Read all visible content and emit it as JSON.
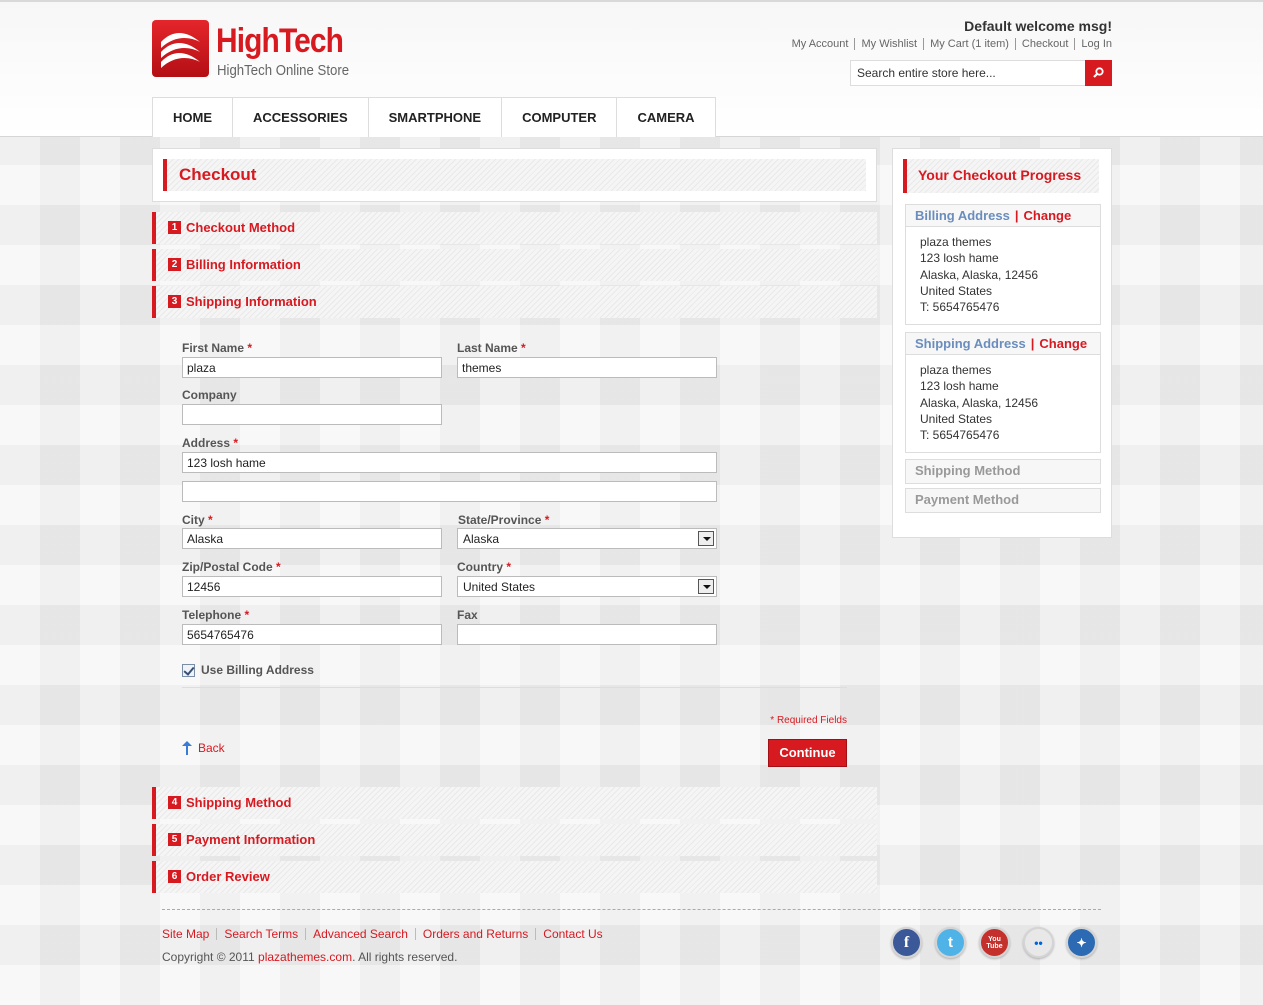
{
  "brand": {
    "title": "HighTech",
    "subtitle": "HighTech Online Store"
  },
  "header": {
    "welcome": "Default welcome msg!",
    "links": [
      "My Account",
      "My Wishlist",
      "My Cart (1 item)",
      "Checkout",
      "Log In"
    ],
    "search_placeholder": "Search entire store here..."
  },
  "nav": [
    "HOME",
    "ACCESSORIES",
    "SMARTPHONE",
    "COMPUTER",
    "CAMERA"
  ],
  "page_title": "Checkout",
  "steps": [
    {
      "num": "1",
      "label": "Checkout Method"
    },
    {
      "num": "2",
      "label": "Billing Information"
    },
    {
      "num": "3",
      "label": "Shipping Information"
    },
    {
      "num": "4",
      "label": "Shipping Method"
    },
    {
      "num": "5",
      "label": "Payment Information"
    },
    {
      "num": "6",
      "label": "Order Review"
    }
  ],
  "form": {
    "required_mark": "*",
    "first_name": {
      "label": "First Name",
      "value": "plaza"
    },
    "last_name": {
      "label": "Last Name",
      "value": "themes"
    },
    "company": {
      "label": "Company",
      "value": ""
    },
    "address": {
      "label": "Address",
      "line1": "123 losh hame",
      "line2": ""
    },
    "city": {
      "label": "City",
      "value": "Alaska"
    },
    "state": {
      "label": "State/Province",
      "value": "Alaska"
    },
    "zip": {
      "label": "Zip/Postal Code",
      "value": "12456"
    },
    "country": {
      "label": "Country",
      "value": "United States"
    },
    "telephone": {
      "label": "Telephone",
      "value": "5654765476"
    },
    "fax": {
      "label": "Fax",
      "value": ""
    },
    "use_billing": {
      "label": "Use Billing Address",
      "checked": true
    },
    "required_note": "* Required Fields",
    "back_label": "Back",
    "continue_label": "Continue"
  },
  "sidebar": {
    "title": "Your Checkout Progress",
    "change_label": "Change",
    "separator": "|",
    "billing": {
      "heading": "Billing Address",
      "lines": [
        "plaza themes",
        "123 losh hame",
        "Alaska, Alaska, 12456",
        "United States",
        "T: 5654765476"
      ]
    },
    "shipping": {
      "heading": "Shipping Address",
      "lines": [
        "plaza themes",
        "123 losh hame",
        "Alaska, Alaska, 12456",
        "United States",
        "T: 5654765476"
      ]
    },
    "shipping_method": "Shipping Method",
    "payment_method": "Payment Method"
  },
  "footer": {
    "links": [
      "Site Map",
      "Search Terms",
      "Advanced Search",
      "Orders and Returns",
      "Contact Us"
    ],
    "copyright_prefix": "Copyright © 2011 ",
    "copyright_site": "plazathemes.com",
    "copyright_suffix": ". All rights reserved.",
    "social": [
      {
        "name": "facebook-icon",
        "glyph": "f",
        "color": "#3b5998"
      },
      {
        "name": "twitter-icon",
        "glyph": "t",
        "color": "#4fb3e8"
      },
      {
        "name": "youtube-icon",
        "glyph": "You Tube",
        "color": "#c4302b"
      },
      {
        "name": "flickr-icon",
        "glyph": "••",
        "color": "#e8e8e8"
      },
      {
        "name": "myspace-icon",
        "glyph": "✦",
        "color": "#2d6ab4"
      }
    ]
  },
  "colors": {
    "accent": "#d71920",
    "link_blue": "#6a8dbd"
  }
}
